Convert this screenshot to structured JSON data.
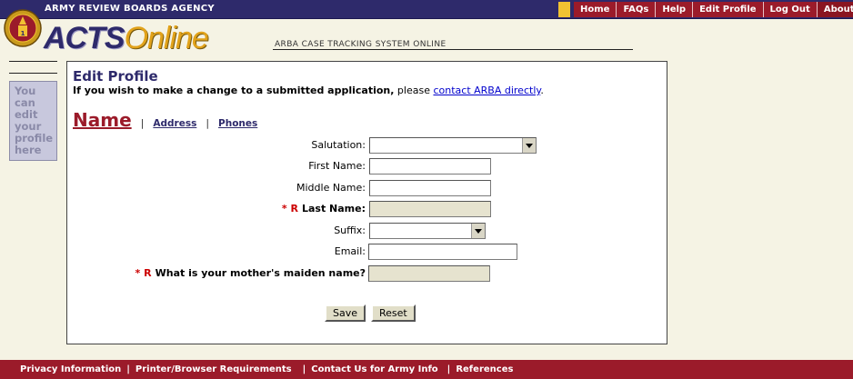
{
  "header": {
    "agency": "ARMY REVIEW BOARDS AGENCY",
    "nav": [
      {
        "label": "Home"
      },
      {
        "label": "FAQs"
      },
      {
        "label": "Help"
      },
      {
        "label": "Edit Profile"
      },
      {
        "label": "Log Out"
      },
      {
        "label": "About"
      }
    ]
  },
  "logo": {
    "acts": "ACTS",
    "online": "Online",
    "subtitle": "ARBA CASE TRACKING SYSTEM ONLINE"
  },
  "sidebar": {
    "note": "You can edit your profile here"
  },
  "main": {
    "title": "Edit Profile",
    "notice_bold": "If you wish to make a change to a submitted application,",
    "notice_plain": " please ",
    "notice_link": "contact ARBA directly",
    "notice_end": ".",
    "tabs": {
      "active": "Name",
      "sep": "|",
      "address": "Address",
      "phones": "Phones"
    }
  },
  "form": {
    "required_marker": "* R",
    "salutation": {
      "label": "Salutation:",
      "value": ""
    },
    "first_name": {
      "label": "First Name:",
      "value": ""
    },
    "middle_name": {
      "label": "Middle Name:",
      "value": ""
    },
    "last_name": {
      "label": "Last Name:",
      "value": ""
    },
    "suffix": {
      "label": "Suffix:",
      "value": ""
    },
    "email": {
      "label": "Email:",
      "value": ""
    },
    "maiden": {
      "label": "What is your mother's maiden name?",
      "value": ""
    },
    "save": "Save",
    "reset": "Reset"
  },
  "footer": {
    "links": [
      "Privacy Information",
      "Printer/Browser Requirements",
      "Contact Us for Army Info",
      "References"
    ],
    "sep": "|"
  },
  "colors": {
    "navy": "#2e2a6b",
    "maroon": "#9b1b2a",
    "gold": "#e1a21a",
    "background": "#f5f3e4"
  }
}
